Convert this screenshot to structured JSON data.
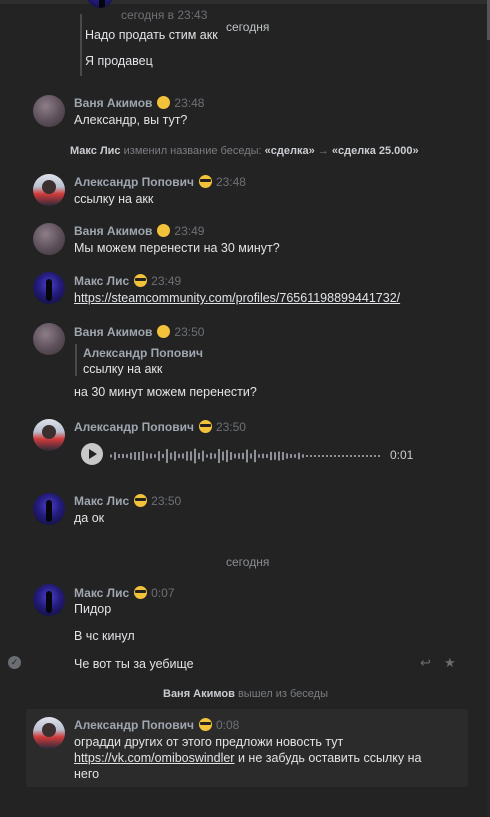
{
  "top": {
    "partial_meta": "сегодня в 23:43",
    "date_tooltip": "сегодня",
    "lines": [
      "Надо продать стим акк",
      "Я продавец"
    ]
  },
  "messages": {
    "m1": {
      "author": "Ваня Акимов",
      "time": "23:48",
      "text": "Александр, вы тут?"
    },
    "sys1": {
      "actor": "Макс Лис",
      "action": "изменил название беседы:",
      "from": "«сделка»",
      "arrow": "→",
      "to": "«сделка 25.000»"
    },
    "m2": {
      "author": "Александр Попович",
      "time": "23:48",
      "text": "ссылку на акк"
    },
    "m3": {
      "author": "Ваня Акимов",
      "time": "23:49",
      "text": "Мы можем перенести на 30 минут?"
    },
    "m4": {
      "author": "Макс Лис",
      "time": "23:49",
      "link": "https://steamcommunity.com/profiles/76561198899441732/"
    },
    "m5": {
      "author": "Ваня Акимов",
      "time": "23:50",
      "quote_author": "Александр Попович",
      "quote_text": "ссылку на акк",
      "text": "на 30 минут можем перенести?"
    },
    "m6": {
      "author": "Александр Попович",
      "time": "23:50",
      "duration": "0:01"
    },
    "m7": {
      "author": "Макс Лис",
      "time": "23:50",
      "text": "да ок"
    },
    "date2": "сегодня",
    "m8": {
      "author": "Макс Лис",
      "time": "0:07",
      "lines": [
        "Пидор",
        "В чс кинул",
        "Че вот ты за уебище"
      ]
    },
    "sys2": {
      "actor": "Ваня Акимов",
      "action": "вышел из беседы"
    },
    "m9": {
      "author": "Александр Попович",
      "time": "0:08",
      "line1": "оградди других от этого предложи новость тут",
      "link": "https://vk.com/omiboswindler",
      "after_link": " и не забудь оставить ссылку на",
      "line3": "него"
    }
  },
  "icons": {
    "tongue_emoji": "face-with-tongue-emoji",
    "cool_emoji": "sunglasses-emoji",
    "reply": "reply-icon",
    "star": "star-icon",
    "check": "check-icon",
    "play": "play-icon"
  }
}
